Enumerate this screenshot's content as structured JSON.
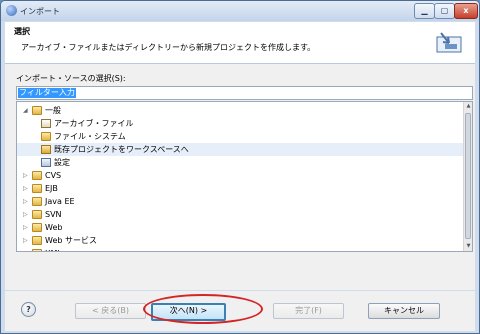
{
  "window": {
    "title": "インポート",
    "min_label": "▁",
    "max_label": "▢",
    "close_label": "x"
  },
  "header": {
    "title": "選択",
    "description": "アーカイブ・ファイルまたはディレクトリーから新規プロジェクトを作成します。"
  },
  "import_source": {
    "label": "インポート・ソースの選択(S):",
    "filter_value": "フィルター入力"
  },
  "tree": {
    "items": [
      {
        "label": "一般",
        "type": "folder",
        "expanded": true,
        "level": 0
      },
      {
        "label": "アーカイブ・ファイル",
        "type": "archive",
        "level": 1
      },
      {
        "label": "ファイル・システム",
        "type": "folder",
        "level": 1
      },
      {
        "label": "既存プロジェクトをワークスペースへ",
        "type": "project",
        "level": 1,
        "selected": true
      },
      {
        "label": "設定",
        "type": "settings",
        "level": 1
      },
      {
        "label": "CVS",
        "type": "folder",
        "expanded": false,
        "level": 0
      },
      {
        "label": "EJB",
        "type": "folder",
        "expanded": false,
        "level": 0
      },
      {
        "label": "Java EE",
        "type": "folder",
        "expanded": false,
        "level": 0
      },
      {
        "label": "SVN",
        "type": "folder",
        "expanded": false,
        "level": 0
      },
      {
        "label": "Web",
        "type": "folder",
        "expanded": false,
        "level": 0
      },
      {
        "label": "Web サービス",
        "type": "folder",
        "expanded": false,
        "level": 0
      },
      {
        "label": "XML",
        "type": "folder",
        "expanded": false,
        "level": 0
      }
    ]
  },
  "buttons": {
    "help": "?",
    "back": "< 戻る(B)",
    "next": "次へ(N) >",
    "finish": "完了(F)",
    "cancel": "キャンセル"
  },
  "colors": {
    "accent": "#3399ff",
    "highlight_oval": "#d42525"
  }
}
